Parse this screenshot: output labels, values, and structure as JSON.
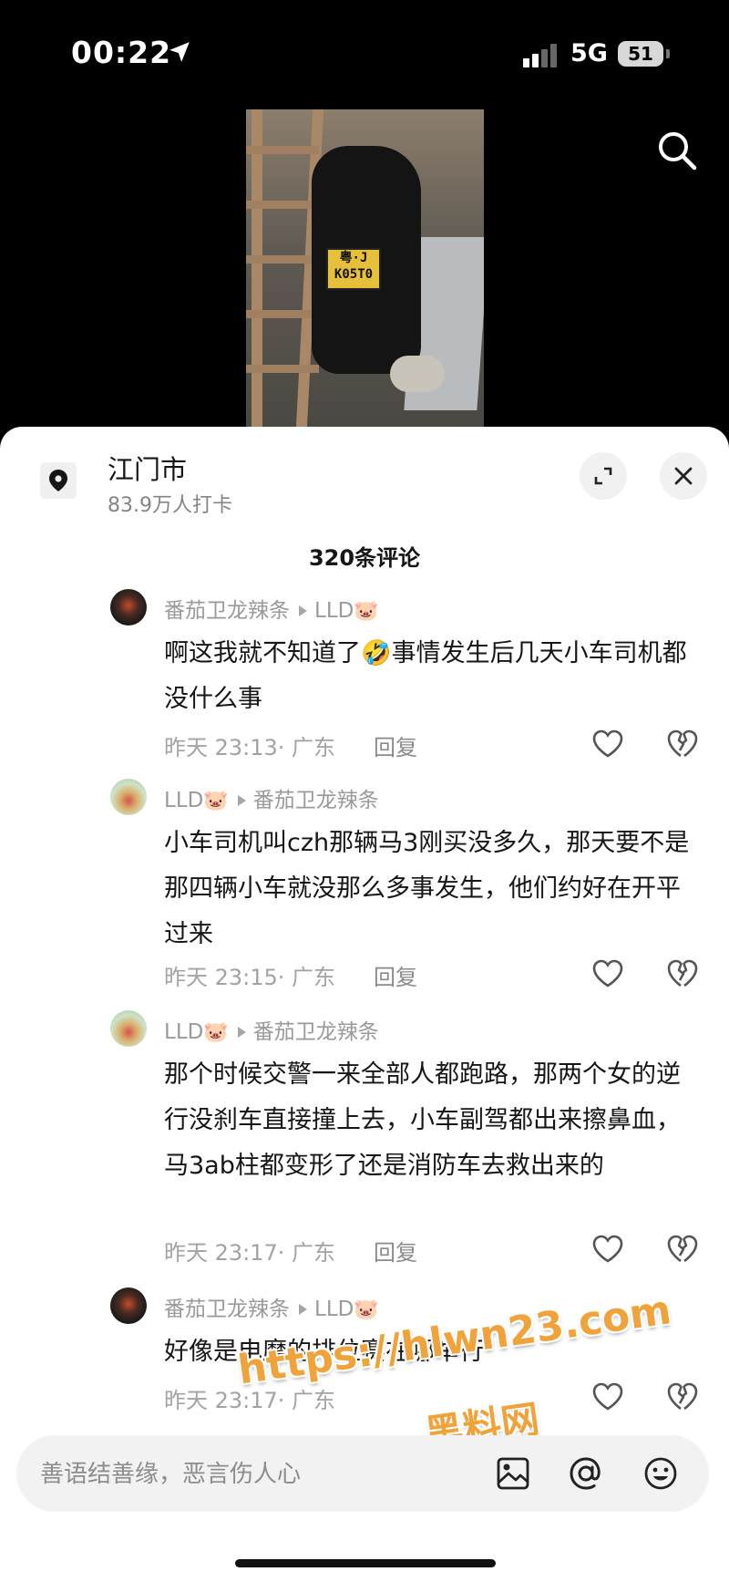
{
  "status_bar": {
    "time": "00:22",
    "network": "5G",
    "battery": "51"
  },
  "location": {
    "title": "江门市",
    "subtitle": "83.9万人打卡"
  },
  "comments_header": {
    "count_label": "320条评论"
  },
  "comments": [
    {
      "author": "番茄卫龙辣条",
      "reply_to": "LLD",
      "text": "啊这我就不知道了🤣事情发生后几天小车司机都没什么事",
      "time": "昨天 23:13",
      "region": "· 广东",
      "reply_label": "回复",
      "avatar": "dark"
    },
    {
      "author": "LLD",
      "reply_to": "番茄卫龙辣条",
      "text": "小车司机叫czh那辆马3刚买没多久，那天要不是那四辆小车就没那么多事发生，他们约好在开平过来",
      "time": "昨天 23:15",
      "region": "· 广东",
      "reply_label": "回复",
      "avatar": "light"
    },
    {
      "author": "LLD",
      "reply_to": "番茄卫龙辣条",
      "text": "那个时候交警一来全部人都跑路，那两个女的逆行没刹车直接撞上去，小车副驾都出来擦鼻血，马3ab柱都变形了还是消防车去救出来的",
      "time": "昨天 23:17",
      "region": "· 广东",
      "reply_label": "回复",
      "avatar": "light"
    },
    {
      "author": "番茄卫龙辣条",
      "reply_to": "LLD",
      "text": "好像是电摩的排位赛在哪举行",
      "time": "昨天 23:17",
      "region": "· 广东",
      "reply_label": "",
      "avatar": "dark"
    }
  ],
  "input": {
    "placeholder": "善语结善缘，恶言伤人心"
  },
  "video": {
    "plate_line1": "粤·J",
    "plate_line2": "K05T0"
  },
  "watermark": {
    "url": "https://hlwn23.com",
    "name": "黑料网"
  },
  "icons": {
    "location": "location-pin-icon",
    "expand": "expand-icon",
    "close": "close-icon",
    "search": "search-icon",
    "like": "heart-icon",
    "dislike": "broken-heart-icon",
    "image": "image-icon",
    "mention": "at-icon",
    "emoji": "emoji-icon"
  },
  "colors": {
    "panel_bg": "#ffffff",
    "text_primary": "#161616",
    "text_secondary": "#9a9a9a",
    "watermark": "#f0a33a"
  }
}
